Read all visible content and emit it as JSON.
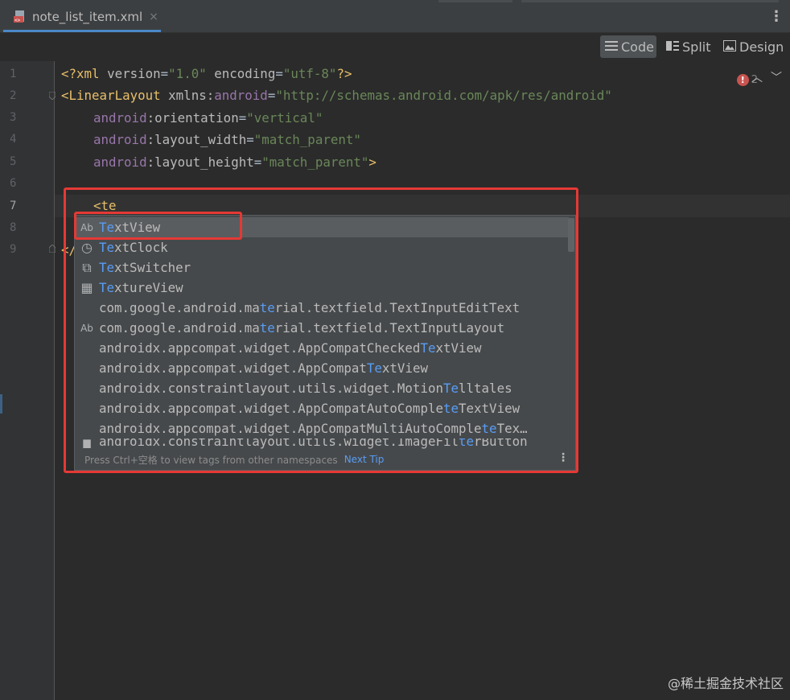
{
  "tab": {
    "filename": "note_list_item.xml",
    "close_glyph": "×"
  },
  "view_modes": [
    {
      "label": "Code",
      "icon": "lines-icon",
      "active": true
    },
    {
      "label": "Split",
      "icon": "split-icon",
      "active": false
    },
    {
      "label": "Design",
      "icon": "image-icon",
      "active": false
    }
  ],
  "gutter": {
    "line_numbers": [
      "1",
      "2",
      "3",
      "4",
      "5",
      "6",
      "7",
      "8",
      "9"
    ],
    "current_line": "7"
  },
  "inspection": {
    "error_count": "2",
    "error_glyph": "!"
  },
  "code_lines": {
    "l1": {
      "a": "<?",
      "b": "xml ",
      "c": "version",
      "d": "=",
      "e": "\"1.0\"",
      "f": " encoding",
      "g": "=",
      "h": "\"utf-8\"",
      "i": "?>"
    },
    "l2": {
      "a": "<",
      "b": "LinearLayout ",
      "c": "xmlns:",
      "d": "android",
      "e": "=",
      "f": "\"http://schemas.android.com/apk/res/android\""
    },
    "l3": {
      "ns": "android",
      "attr": ":orientation",
      "eq": "=",
      "val": "\"vertical\""
    },
    "l4": {
      "ns": "android",
      "attr": ":layout_width",
      "eq": "=",
      "val": "\"match_parent\""
    },
    "l5": {
      "ns": "android",
      "attr": ":layout_height",
      "eq": "=",
      "val": "\"match_parent\"",
      "end": ">"
    },
    "l7": {
      "typed": "<te"
    },
    "l9": {
      "partial": "</"
    }
  },
  "completion": {
    "items": [
      {
        "icon_text": "Ab",
        "pre": "",
        "hl": "Te",
        "post": "xtView"
      },
      {
        "icon_text": "◷",
        "pre": "",
        "hl": "Te",
        "post": "xtClock"
      },
      {
        "icon_text": "⧉",
        "pre": "",
        "hl": "Te",
        "post": "xtSwitcher"
      },
      {
        "icon_text": "▦",
        "pre": "",
        "hl": "Te",
        "post": "xtureView"
      },
      {
        "icon_text": "",
        "pre": "com.google.android.ma",
        "hl": "te",
        "post": "rial.textfield.TextInputEditText"
      },
      {
        "icon_text": "Ab",
        "pre": "com.google.android.ma",
        "hl": "te",
        "post": "rial.textfield.TextInputLayout"
      },
      {
        "icon_text": "",
        "pre": "androidx.appcompat.widget.AppCompatChecked",
        "hl": "Te",
        "post": "xtView"
      },
      {
        "icon_text": "",
        "pre": "androidx.appcompat.widget.AppCompat",
        "hl": "Te",
        "post": "xtView"
      },
      {
        "icon_text": "",
        "pre": "androidx.constraintlayout.utils.widget.Motion",
        "hl": "Te",
        "post": "lltales"
      },
      {
        "icon_text": "",
        "pre": "androidx.appcompat.widget.AppCompatAutoComple",
        "hl": "te",
        "post": "TextView"
      },
      {
        "icon_text": "",
        "pre": "androidx.appcompat.widget.AppCompatMultiAutoComple",
        "hl": "te",
        "post": "Tex…"
      },
      {
        "icon_text": "▆",
        "pre": "androidx.constraintlayout.utils.widget.ImageFil",
        "hl": "te",
        "post": "rButton"
      }
    ],
    "footer_text": "Press Ctrl+空格 to view tags from other namespaces",
    "footer_link": "Next Tip"
  },
  "watermark": "@稀土掘金技术社区",
  "colors": {
    "accent": "#4a88c7",
    "highlight_match": "#589df6",
    "annotation_red": "#e53935",
    "error": "#c75450"
  }
}
